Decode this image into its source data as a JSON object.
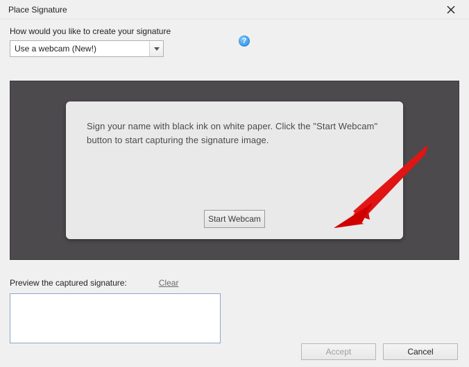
{
  "window": {
    "title": "Place Signature"
  },
  "prompt": {
    "label": "How would you like to create your signature",
    "selected": "Use a webcam (New!)"
  },
  "panel": {
    "instructions": "Sign your name with black ink on white paper. Click the \"Start Webcam\" button to start capturing the signature image.",
    "start_label": "Start Webcam"
  },
  "preview": {
    "label": "Preview the captured signature:",
    "clear_label": "Clear"
  },
  "footer": {
    "accept": "Accept",
    "cancel": "Cancel"
  }
}
